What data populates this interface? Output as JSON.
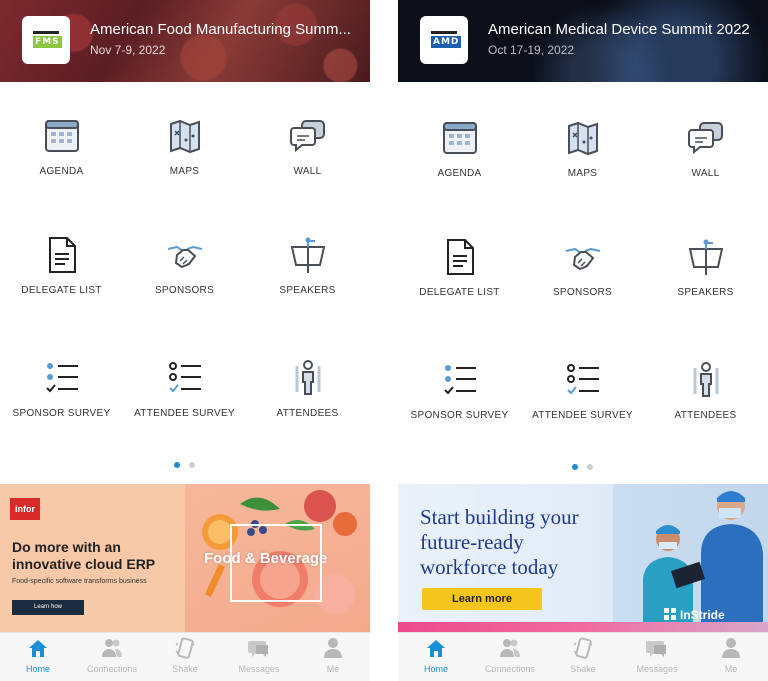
{
  "phones": [
    {
      "header": {
        "title": "American Food Manufacturing Summ...",
        "date": "Nov 7-9, 2022",
        "logo_text": "FMS"
      },
      "tiles": [
        {
          "label": "AGENDA"
        },
        {
          "label": "MAPS"
        },
        {
          "label": "WALL"
        },
        {
          "label": "DELEGATE LIST"
        },
        {
          "label": "SPONSORS"
        },
        {
          "label": "SPEAKERS"
        },
        {
          "label": "SPONSOR SURVEY"
        },
        {
          "label": "ATTENDEE SURVEY"
        },
        {
          "label": "ATTENDEES"
        }
      ],
      "pager": {
        "pages": 2,
        "active": 1
      },
      "ad": {
        "brand": "infor",
        "headline": "Do more with an innovative cloud ERP",
        "subline": "Food-specific software transforms business",
        "button": "Learn how",
        "overlay": "Food & Beverage"
      },
      "tabs": [
        {
          "label": "Home",
          "icon": "home-icon",
          "active": true
        },
        {
          "label": "Connections",
          "icon": "connections-icon",
          "active": false
        },
        {
          "label": "Shake",
          "icon": "shake-icon",
          "active": false
        },
        {
          "label": "Messages",
          "icon": "messages-icon",
          "active": false
        },
        {
          "label": "Me",
          "icon": "person-icon",
          "active": false
        }
      ]
    },
    {
      "header": {
        "title": "American Medical Device Summit 2022",
        "date": "Oct 17-19, 2022",
        "logo_text": "AMD"
      },
      "tiles": [
        {
          "label": "AGENDA"
        },
        {
          "label": "MAPS"
        },
        {
          "label": "WALL"
        },
        {
          "label": "DELEGATE LIST"
        },
        {
          "label": "SPONSORS"
        },
        {
          "label": "SPEAKERS"
        },
        {
          "label": "SPONSOR SURVEY"
        },
        {
          "label": "ATTENDEE SURVEY"
        },
        {
          "label": "ATTENDEES"
        }
      ],
      "pager": {
        "pages": 2,
        "active": 1
      },
      "ad": {
        "line1": "Start building your",
        "line2": "future-ready",
        "line3": "workforce today",
        "button": "Learn more",
        "brand": "InStride"
      },
      "tabs": [
        {
          "label": "Home",
          "icon": "home-icon",
          "active": true
        },
        {
          "label": "Connections",
          "icon": "connections-icon",
          "active": false
        },
        {
          "label": "Shake",
          "icon": "shake-icon",
          "active": false
        },
        {
          "label": "Messages",
          "icon": "messages-icon",
          "active": false
        },
        {
          "label": "Me",
          "icon": "person-icon",
          "active": false
        }
      ]
    }
  ],
  "colors": {
    "accent": "#1a8fd6",
    "icon_stroke": "#4a4f57",
    "icon_blue": "#5b9bd5",
    "tab_inactive": "#b8b8b8"
  }
}
